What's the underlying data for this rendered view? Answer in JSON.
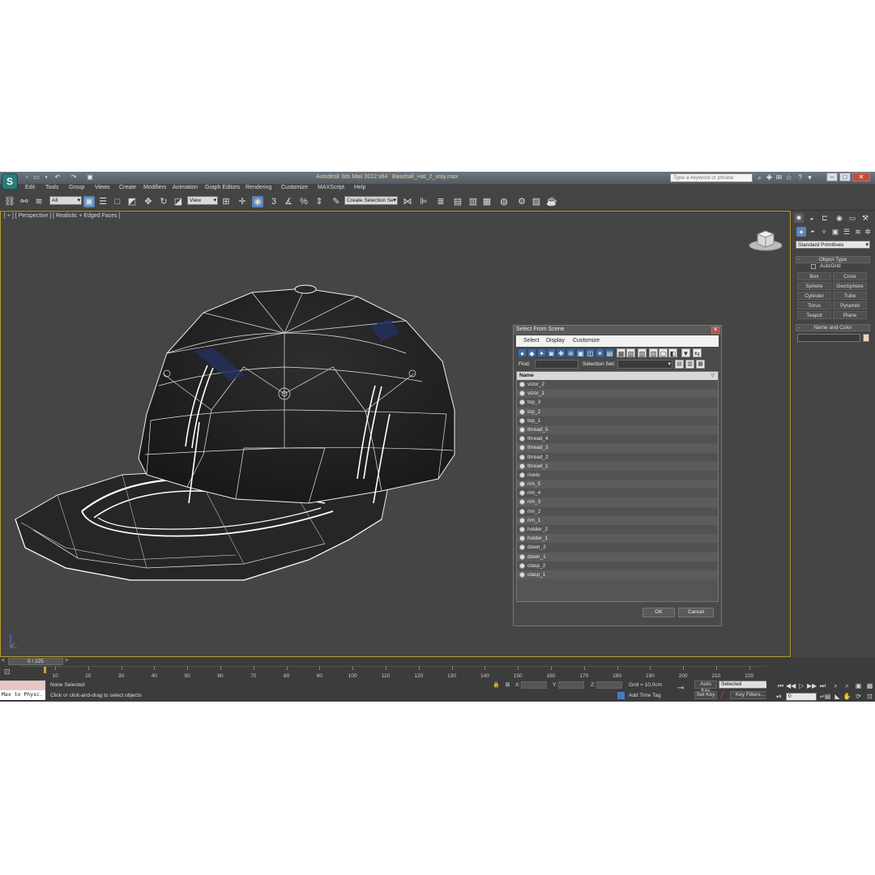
{
  "window": {
    "title": "Autodesk 3ds Max  2012 x64",
    "filename": "Baseball_Hat_2_vray.max",
    "search_placeholder": "Type a keyword or phrase",
    "logo": "app-logo-icon"
  },
  "menu": [
    "Edit",
    "Tools",
    "Group",
    "Views",
    "Create",
    "Modifiers",
    "Animation",
    "Graph Editors",
    "Rendering",
    "Customize",
    "MAXScript",
    "Help"
  ],
  "toolbar": {
    "filter_value": "All",
    "ref_coord_value": "View",
    "selection_set_placeholder": "Create Selection Se"
  },
  "viewport": {
    "label": "[ + ] [ Perspective ] [ Realistic + Edged Faces ]",
    "viewcube_label": "viewcube-icon"
  },
  "dialog": {
    "title": "Select From Scene",
    "menus": [
      "Select",
      "Display",
      "Customize"
    ],
    "find_label": "Find:",
    "selection_set_label": "Selection Set:",
    "column_header": "Name",
    "objects": [
      "vizor_2",
      "vizor_1",
      "top_3",
      "top_2",
      "top_1",
      "thread_5",
      "thread_4",
      "thread_3",
      "thread_2",
      "thread_1",
      "rivets",
      "rim_5",
      "rim_4",
      "rim_3",
      "rim_2",
      "rim_1",
      "holder_2",
      "holder_1",
      "down_2",
      "down_1",
      "clasp_2",
      "clasp_1"
    ],
    "ok_label": "OK",
    "cancel_label": "Cancel"
  },
  "command_panel": {
    "category_value": "Standard Primitives",
    "object_type_title": "Object Type",
    "autogrid_label": "AutoGrid",
    "buttons": [
      "Box",
      "Cone",
      "Sphere",
      "GeoSphere",
      "Cylinder",
      "Tube",
      "Torus",
      "Pyramid",
      "Teapot",
      "Plane"
    ],
    "name_color_title": "Name and Color"
  },
  "timeline": {
    "frame_counter": "0 / 225",
    "ticks": [
      "10",
      "20",
      "30",
      "40",
      "50",
      "60",
      "70",
      "80",
      "90",
      "100",
      "110",
      "120",
      "130",
      "140",
      "150",
      "160",
      "170",
      "180",
      "190",
      "200",
      "210",
      "220"
    ]
  },
  "status": {
    "maxscript_text": "Max to Physc.",
    "selection_text": "None Selected",
    "prompt_text": "Click or click-and-drag to select objects",
    "x_label": "X:",
    "y_label": "Y:",
    "z_label": "Z:",
    "grid_text": "Grid = 10,0cm",
    "add_time_tag": "Add Time Tag",
    "auto_key": "Auto Key",
    "set_key": "Set Key",
    "selected_value": "Selected",
    "key_filters": "Key Filters...",
    "current_frame": "0"
  },
  "colors": {
    "viewport_bg": "#454545",
    "viewport_border": "#b79a2b",
    "active_tool": "#5b86b8",
    "title_text": "#e4d6a0"
  }
}
